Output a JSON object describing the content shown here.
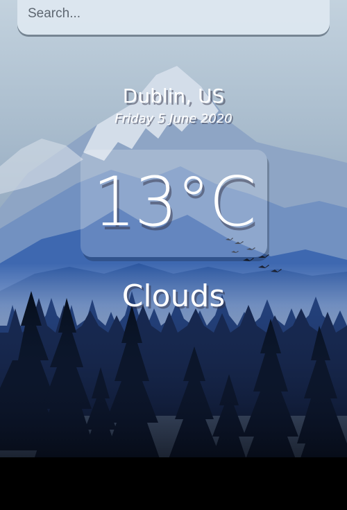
{
  "search": {
    "placeholder": "Search...",
    "value": ""
  },
  "location": {
    "city_country": "Dublin, US",
    "date": "Friday 5 June 2020"
  },
  "weather": {
    "temperature": "13°C",
    "condition": "Clouds"
  },
  "colors": {
    "sky_top": "#b9c9d6",
    "sky_mid": "#8fa6bd",
    "mountain_far": "#7f9cc6",
    "mountain_near": "#2f5fa8",
    "forest_dark": "#0b1120"
  },
  "background": {
    "icon": "mountain-forest-landscape"
  }
}
